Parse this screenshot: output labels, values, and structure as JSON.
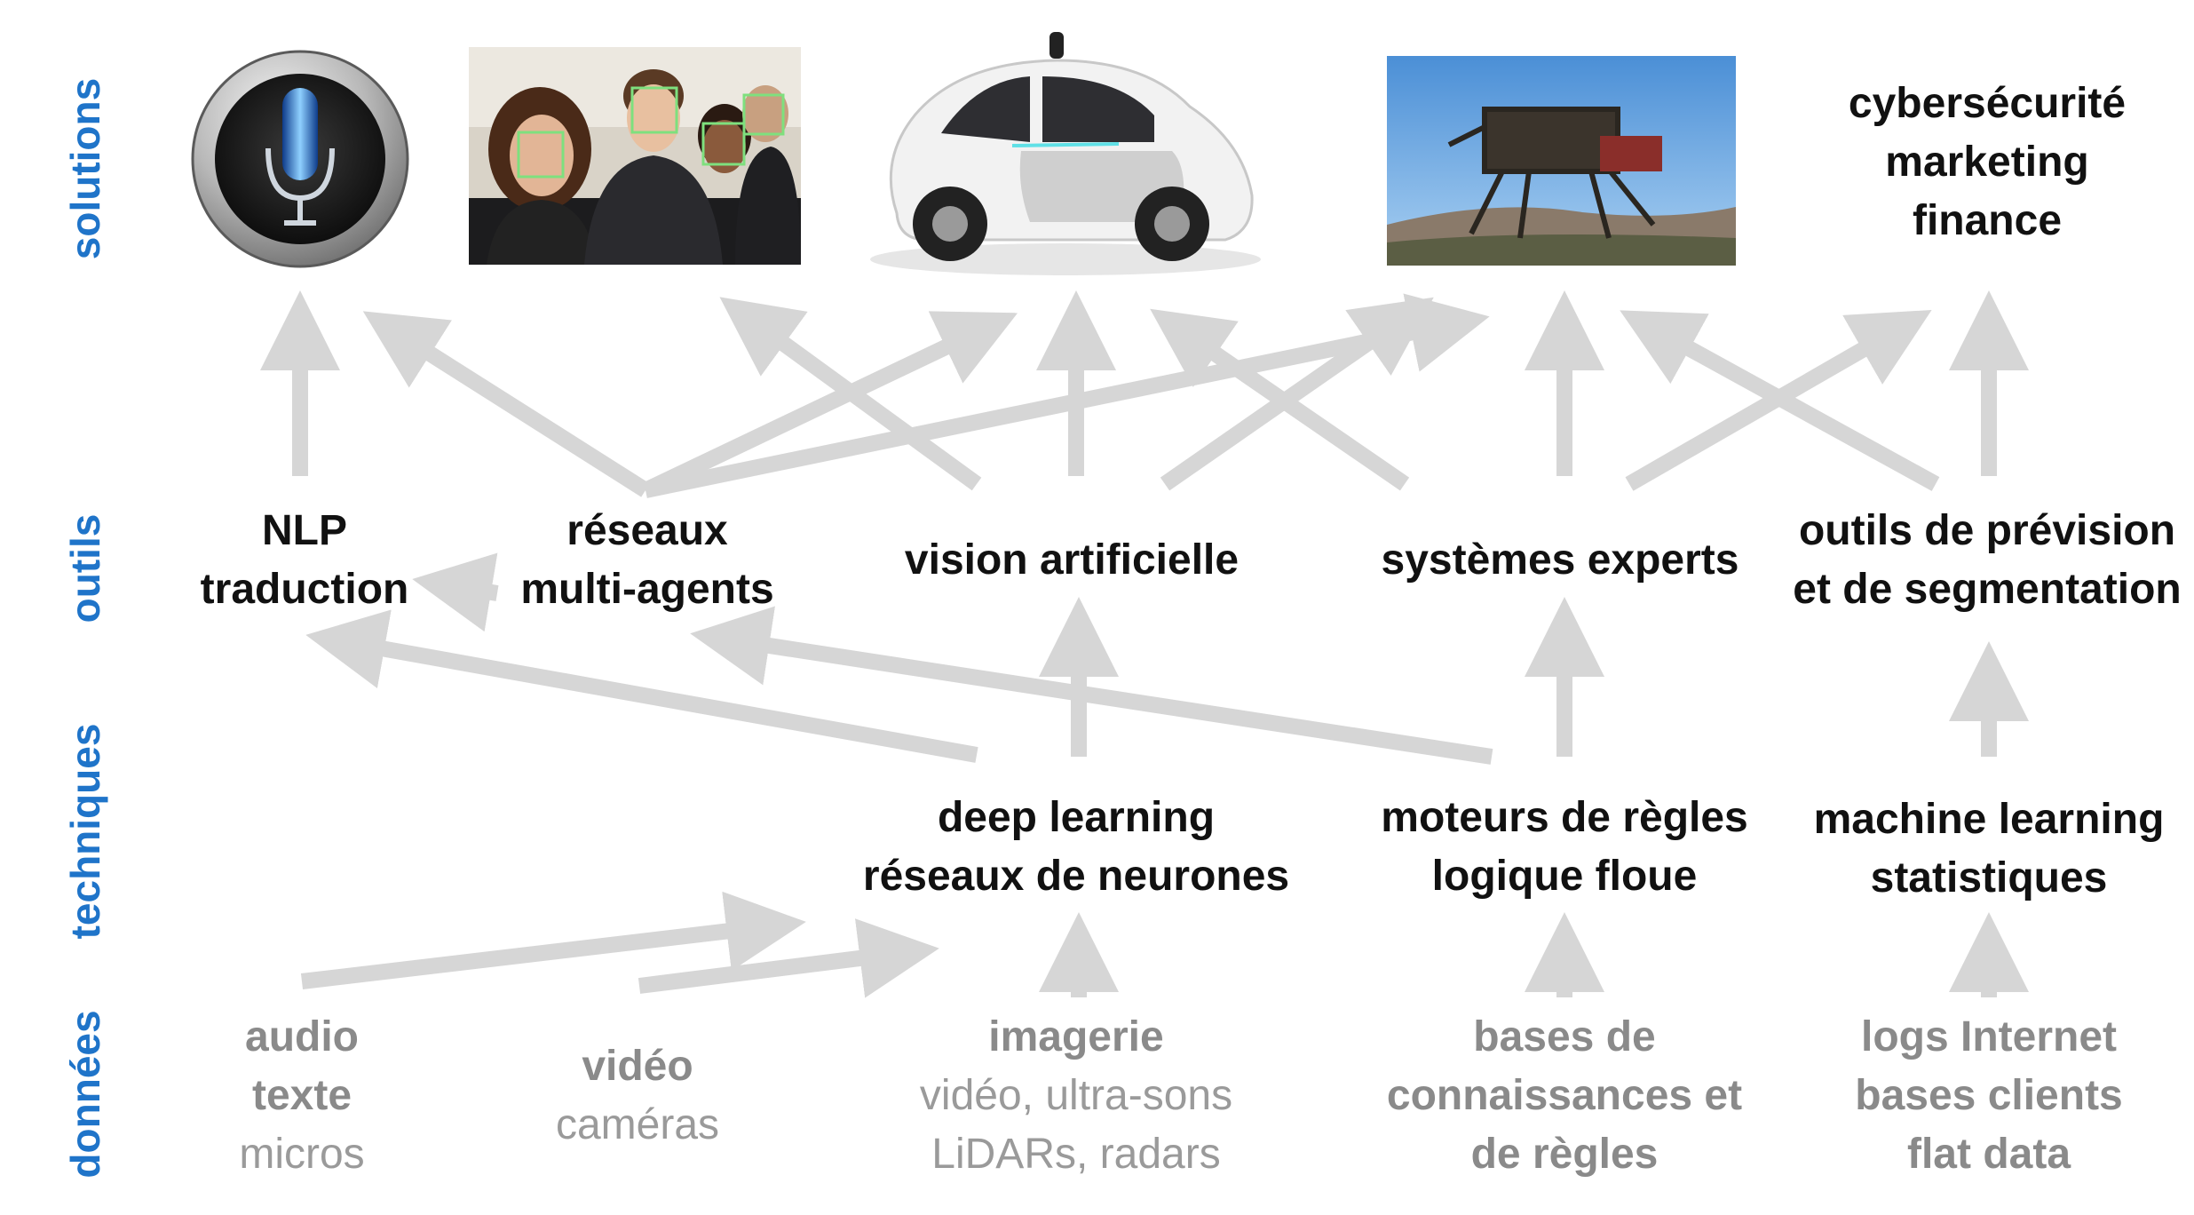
{
  "colors": {
    "row_label": "#1f74c9",
    "arrow": "#d6d6d6",
    "node_text": "#111111",
    "data_text": "#8a8a8a"
  },
  "row_labels": {
    "solutions": "solutions",
    "outils": "outils",
    "techniques": "techniques",
    "donnees": "données"
  },
  "solutions": {
    "siri": {
      "icon": "microphone-icon"
    },
    "face_recognition": {
      "icon": "face-detection-photo"
    },
    "self_driving_car": {
      "icon": "self-driving-car-photo"
    },
    "robot": {
      "icon": "legged-robot-photo"
    },
    "text": [
      "cybersécurité",
      "marketing",
      "finance"
    ]
  },
  "outils": {
    "nlp": [
      "NLP",
      "traduction"
    ],
    "reseaux": [
      "réseaux",
      "multi-agents"
    ],
    "vision": [
      "vision artificielle"
    ],
    "experts": [
      "systèmes experts"
    ],
    "prevision": [
      "outils de prévision",
      "et de segmentation"
    ]
  },
  "techniques": {
    "deep": [
      "deep learning",
      "réseaux de neurones"
    ],
    "moteurs": [
      "moteurs de règles",
      "logique floue"
    ],
    "ml": [
      "machine learning",
      "statistiques"
    ]
  },
  "donnees": {
    "audio": {
      "bold": [
        "audio",
        "texte"
      ],
      "light": [
        "micros"
      ]
    },
    "video": {
      "bold": [
        "vidéo"
      ],
      "light": [
        "caméras"
      ]
    },
    "imagerie": {
      "bold": [
        "imagerie"
      ],
      "light": [
        "vidéo, ultra-sons",
        "LiDARs, radars"
      ]
    },
    "bases": {
      "bold": [
        "bases de",
        "connaissances et",
        "de règles"
      ],
      "light": []
    },
    "logs": {
      "bold": [
        "logs Internet",
        "bases clients",
        "flat data"
      ],
      "light": []
    }
  }
}
